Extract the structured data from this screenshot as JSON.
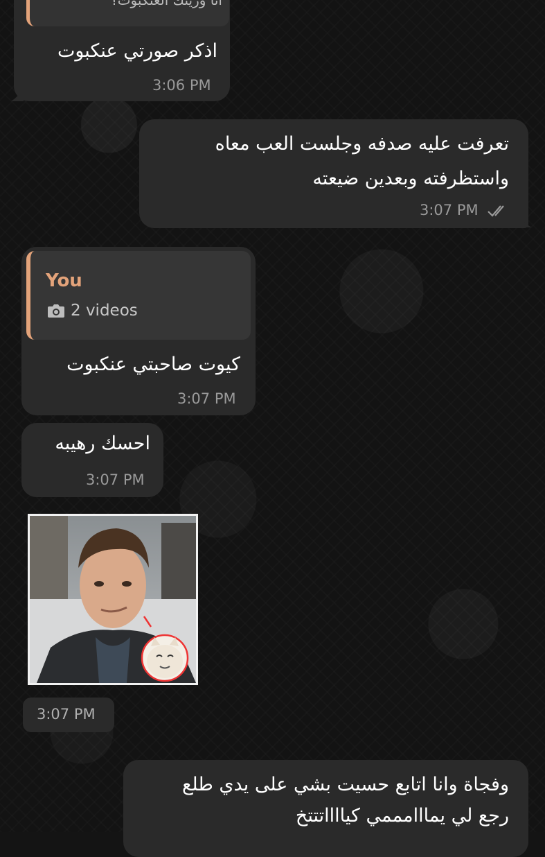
{
  "messages": {
    "m1": {
      "quoted_fragment": "انا وريتك العنكبوت؟",
      "text": "اذكر صورتي عنكبوت",
      "time": "3:06 PM"
    },
    "m2": {
      "line1": "تعرفت عليه صدفه وجلست العب معاه",
      "line2": "واستظرفته وبعدين ضيعته",
      "time": "3:07 PM",
      "status_icon": "double-check-icon"
    },
    "m3": {
      "reply_name": "You",
      "reply_media": "2 videos",
      "reply_icon": "camera-icon",
      "text": "كيوت صاحبتي عنكبوت",
      "time": "3:07 PM"
    },
    "m4": {
      "text": "احسك رهيبه",
      "time": "3:07 PM"
    },
    "m5": {
      "media": "photo",
      "time": "3:07 PM"
    },
    "m6": {
      "line1": "وفجاة وانا اتابع حسيت بشي على يدي طلع",
      "line2": "رجع لي يمااامممي كيااااتتتخ"
    }
  },
  "colors": {
    "bubble": "#2a2a2a",
    "accent": "#e3a37a",
    "background": "#131313",
    "time": "#9a9a9a"
  }
}
